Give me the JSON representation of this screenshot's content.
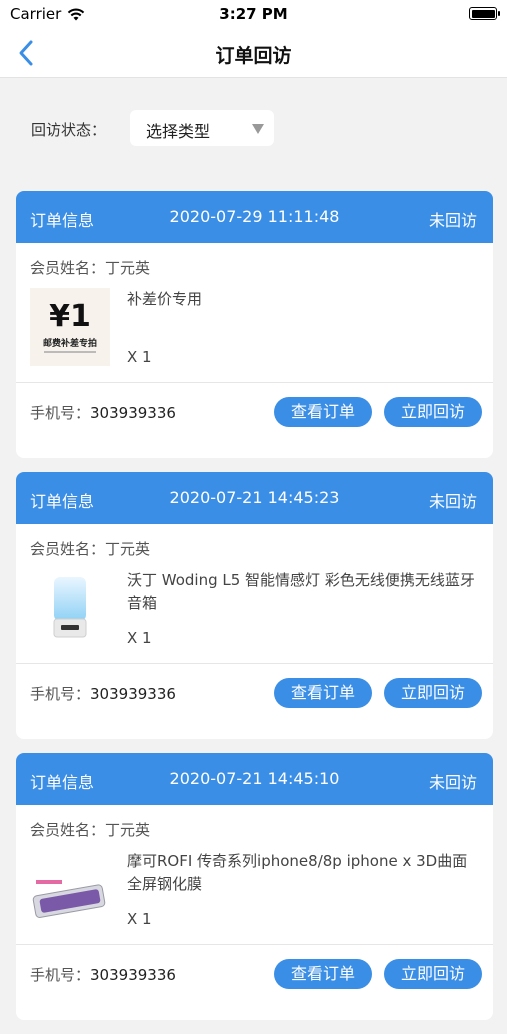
{
  "status_bar": {
    "carrier": "Carrier",
    "time": "3:27 PM"
  },
  "nav": {
    "title": "订单回访"
  },
  "filter": {
    "label": "回访状态：",
    "select_value": "选择类型"
  },
  "orders": [
    {
      "header_label": "订单信息",
      "date": "2020-07-29 11:11:48",
      "status": "未回访",
      "member": "会员姓名：丁元英",
      "product_name": "补差价专用",
      "qty": "X 1",
      "phone_label": "手机号：",
      "phone": "303939336",
      "view_label": "查看订单",
      "visit_label": "立即回访",
      "thumb_text": {
        "big": "¥1",
        "caption": "邮费补差专拍"
      }
    },
    {
      "header_label": "订单信息",
      "date": "2020-07-21 14:45:23",
      "status": "未回访",
      "member": "会员姓名：丁元英",
      "product_name": "沃丁 Woding L5 智能情感灯 彩色无线便携无线蓝牙音箱",
      "qty": "X 1",
      "phone_label": "手机号：",
      "phone": "303939336",
      "view_label": "查看订单",
      "visit_label": "立即回访"
    },
    {
      "header_label": "订单信息",
      "date": "2020-07-21 14:45:10",
      "status": "未回访",
      "member": "会员姓名：丁元英",
      "product_name": "摩可ROFI 传奇系列iphone8/8p iphone x 3D曲面全屏钢化膜",
      "qty": "X 1",
      "phone_label": "手机号：",
      "phone": "303939336",
      "view_label": "查看订单",
      "visit_label": "立即回访"
    }
  ],
  "colors": {
    "accent": "#3a8ee6",
    "background": "#f2f2f2"
  }
}
